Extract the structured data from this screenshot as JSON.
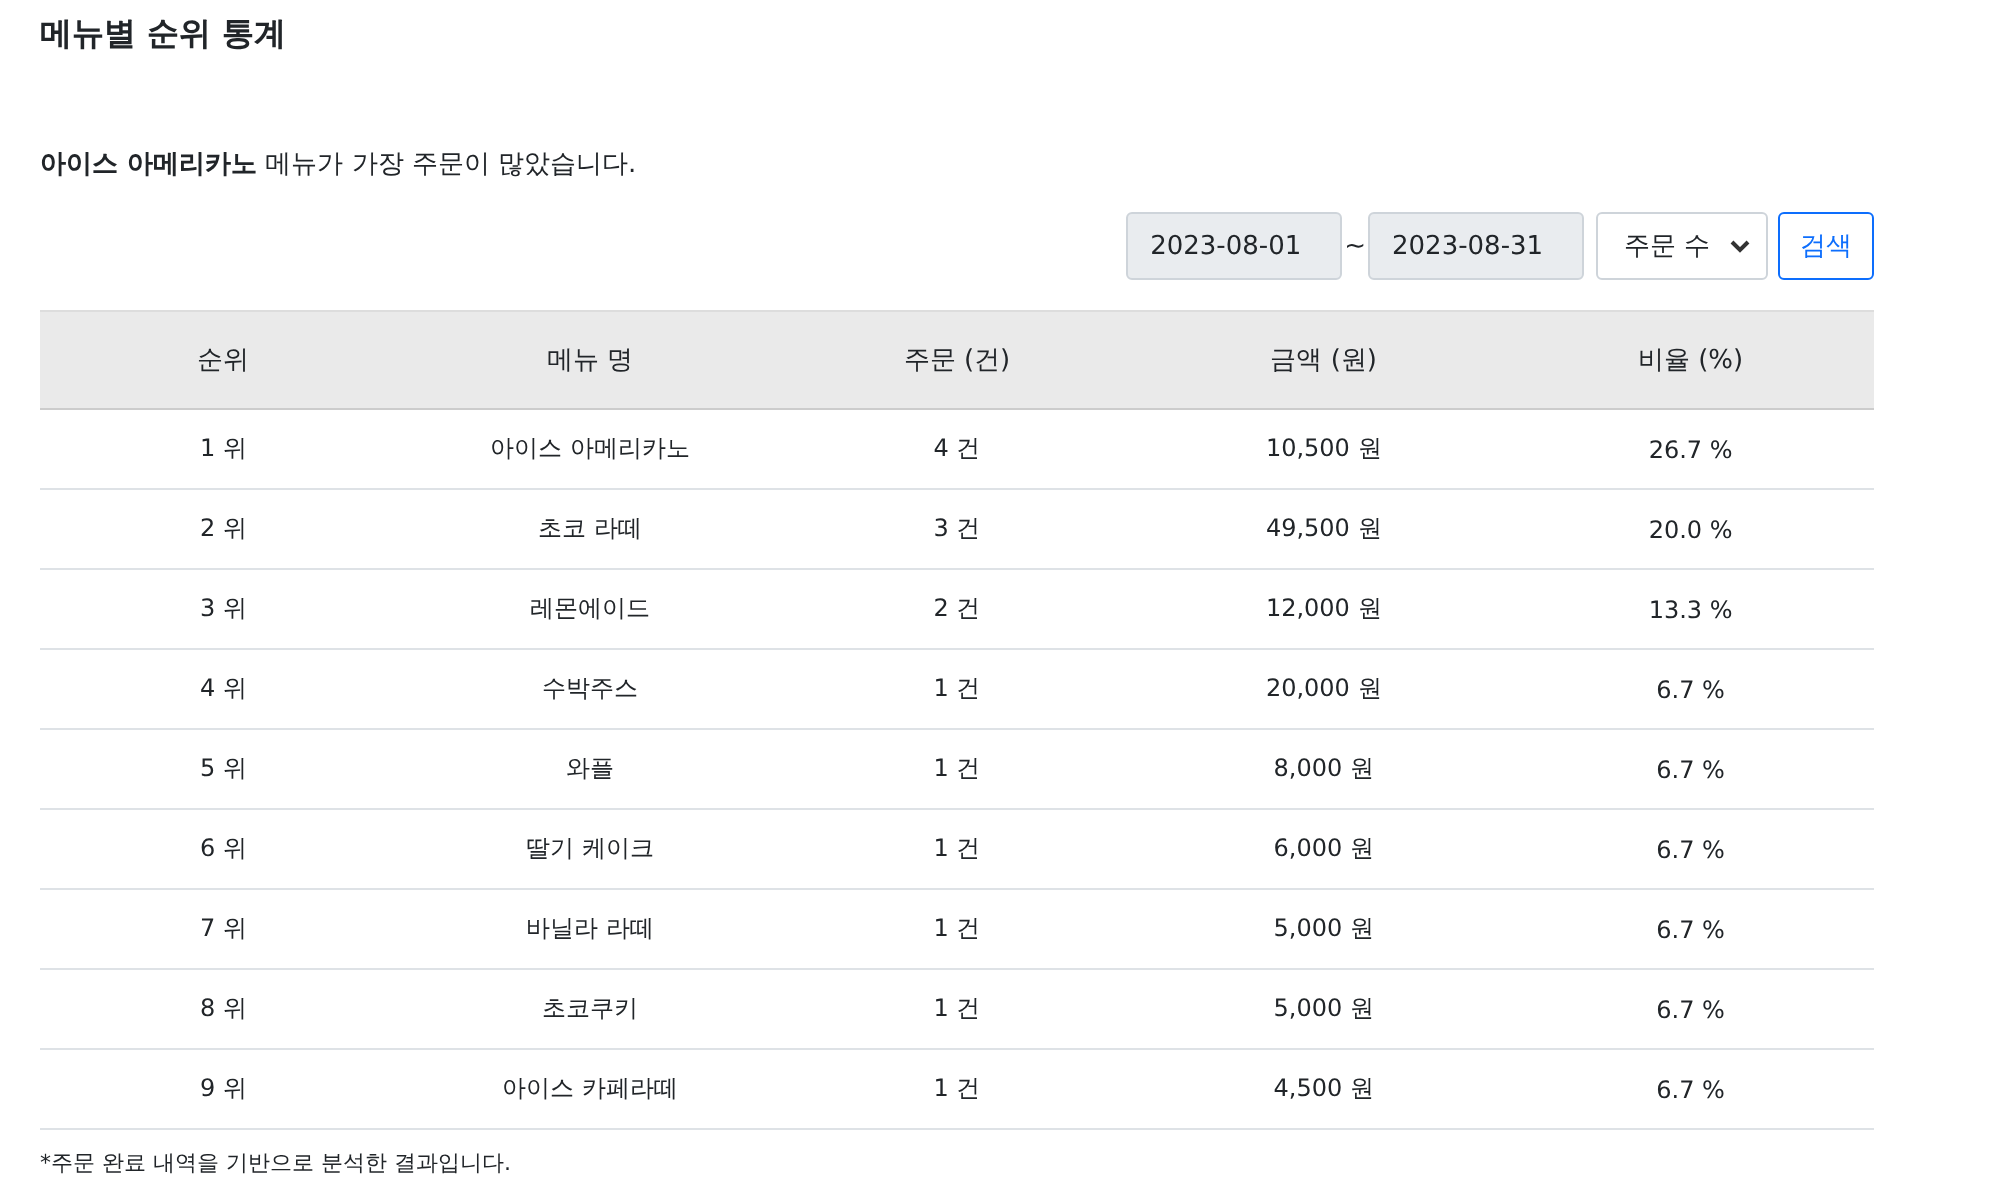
{
  "title": "메뉴별 순위 통계",
  "summary": "**아이스 아메리카노** 메뉴가 가장 주문이 많았습니다.",
  "filters": {
    "start_date": "2023-08-01",
    "separator": "~",
    "end_date": "2023-08-31",
    "sort": "주문 수",
    "search_button": "검색"
  },
  "table": {
    "columns": [
      "순위",
      "메뉴 명",
      "주문 (건)",
      "금액 (원)",
      "비율 (%)"
    ],
    "rows": [
      [
        "1 위",
        "아이스 아메리카노",
        "4 건",
        "10,500 원",
        "26.7 %"
      ],
      [
        "2 위",
        "초코 라떼",
        "3 건",
        "49,500 원",
        "20.0 %"
      ],
      [
        "3 위",
        "레몬에이드",
        "2 건",
        "12,000 원",
        "13.3 %"
      ],
      [
        "4 위",
        "수박주스",
        "1 건",
        "20,000 원",
        "6.7 %"
      ],
      [
        "5 위",
        "와플",
        "1 건",
        "8,000 원",
        "6.7 %"
      ],
      [
        "6 위",
        "딸기 케이크",
        "1 건",
        "6,000 원",
        "6.7 %"
      ],
      [
        "7 위",
        "바닐라 라떼",
        "1 건",
        "5,000 원",
        "6.7 %"
      ],
      [
        "8 위",
        "초코쿠키",
        "1 건",
        "5,000 원",
        "6.7 %"
      ],
      [
        "9 위",
        "아이스 카페라떼",
        "1 건",
        "4,500 원",
        "6.7 %"
      ]
    ]
  },
  "footnote": "*주문 완료 내역을 기반으로 분석한 결과입니다."
}
